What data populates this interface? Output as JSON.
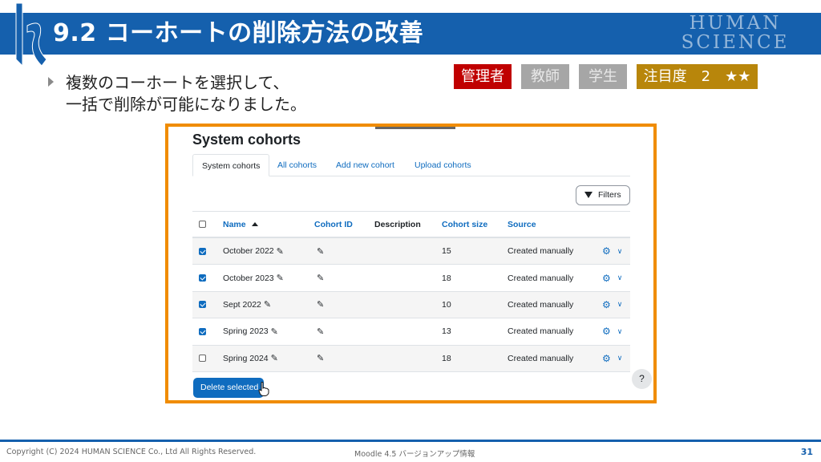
{
  "slide": {
    "title": "9.2 コーホートの削除方法の改善",
    "brand_line1": "HUMAN",
    "brand_line2": "SCIENCE",
    "bullet_line1": "複数のコーホートを選択して、",
    "bullet_line2": "一括で削除が可能になりました。"
  },
  "badges": {
    "admin": "管理者",
    "teacher": "教師",
    "student": "学生",
    "attention": "注目度　2　★★"
  },
  "moodle": {
    "page_title": "System cohorts",
    "tabs": [
      {
        "label": "System cohorts"
      },
      {
        "label": "All cohorts"
      },
      {
        "label": "Add new cohort"
      },
      {
        "label": "Upload cohorts"
      }
    ],
    "filters_label": "Filters",
    "columns": {
      "name": "Name",
      "cohort_id": "Cohort ID",
      "description": "Description",
      "cohort_size": "Cohort size",
      "source": "Source"
    },
    "rows": [
      {
        "name": "October 2022",
        "size": "15",
        "source": "Created manually",
        "checked": true
      },
      {
        "name": "October 2023",
        "size": "18",
        "source": "Created manually",
        "checked": true
      },
      {
        "name": "Sept 2022",
        "size": "10",
        "source": "Created manually",
        "checked": true
      },
      {
        "name": "Spring 2023",
        "size": "13",
        "source": "Created manually",
        "checked": true
      },
      {
        "name": "Spring 2024",
        "size": "18",
        "source": "Created manually",
        "checked": false
      }
    ],
    "delete_label": "Delete selected",
    "help_label": "?"
  },
  "footer": {
    "copyright": "Copyright (C) 2024 HUMAN SCIENCE Co., Ltd All Rights Reserved.",
    "doc_title": "Moodle 4.5 バージョンアップ情報",
    "page_number": "31"
  },
  "colors": {
    "banner": "#1560ad",
    "frame": "#f08c00",
    "admin": "#c00000",
    "inactive": "#a6a6a6",
    "attention": "#b8860b",
    "moodle_primary": "#0f6cbf"
  }
}
